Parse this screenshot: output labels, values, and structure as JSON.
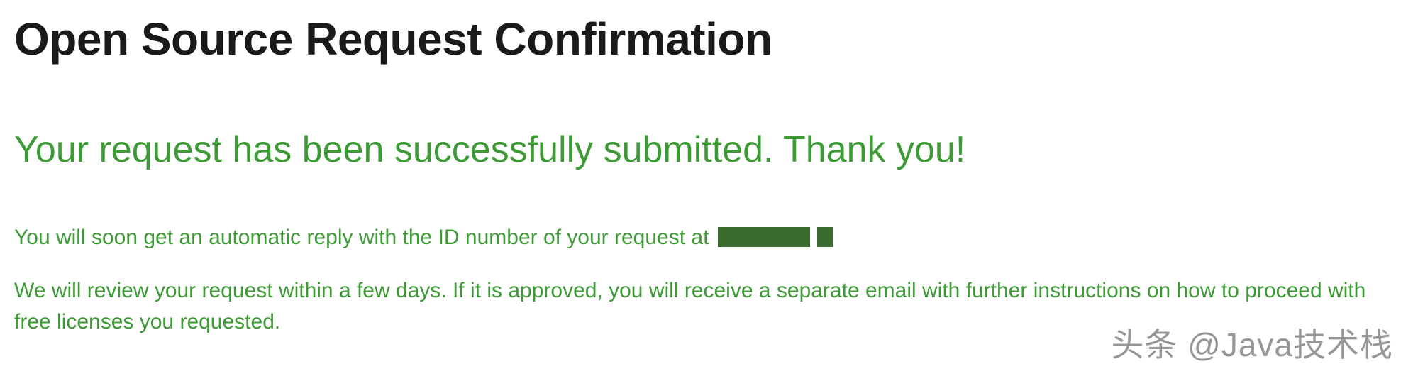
{
  "title": "Open Source Request Confirmation",
  "success_heading": "Your request has been successfully submitted. Thank you!",
  "paragraphs": {
    "auto_reply": "You will soon get an automatic reply with the ID number of your request at",
    "review": "We will review your request within a few days. If it is approved, you will receive a separate email with further instructions on how to proceed with free licenses you requested."
  },
  "colors": {
    "heading": "#1a1a1a",
    "success": "#3d9b35"
  },
  "watermark": "头条 @Java技术栈"
}
